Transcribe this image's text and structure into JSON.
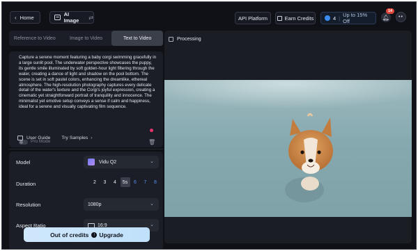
{
  "topbar": {
    "home_label": "Home",
    "ai_image_label": "AI Image",
    "api_label": "API Platform",
    "earn_label": "Earn Credits",
    "credits_count": "4",
    "credits_offer": "Up to 15% Off",
    "notification_count": "14",
    "avatar_glyph": "••"
  },
  "tabs": [
    {
      "label": "Reference to Video",
      "active": false
    },
    {
      "label": "Image to Video",
      "active": false
    },
    {
      "label": "Text to Video",
      "active": true
    }
  ],
  "prompt": {
    "text": "Capture a serene moment featuring a baby corgi swimming gracefully in a large sunlit pool. The underwater perspective showcases the puppy, its gentle smile illuminated by soft golden-hour light filtering through the water, creating a dance of light and shadow on the pool bottom. The scene is set in soft pastel colors, enhancing the dreamlike, ethereal atmosphere. The high-resolution photography captures every delicate detail of the water's texture and the Corgi's joyful expression, creating a cinematic yet straightforward portrait of tranquility and innocence. The minimalist yet emotive setup conveys a sense if calm and happiness, ideal for a serene and visually captivating film sequence.",
    "pro_mode_label": "Pro Mode",
    "pro_mode_on": false
  },
  "links": {
    "user_guide": "User Guide",
    "try_samples": "Try Samples"
  },
  "settings": {
    "model_label": "Model",
    "model_value": "Vidu Q2",
    "duration_label": "Duration",
    "durations": [
      "2",
      "3",
      "4",
      "5s",
      "6",
      "7",
      "8"
    ],
    "duration_selected": "5s",
    "resolution_label": "Resolution",
    "resolution_value": "1080p",
    "aspect_label": "Aspect Ratio",
    "aspect_value": "16:9"
  },
  "action": {
    "out_of_credits": "Out of credits",
    "upgrade": "Upgrade"
  },
  "preview": {
    "status": "Processing"
  },
  "colors": {
    "background": "#0f1117",
    "panel": "#1b1e26",
    "accent_blue": "#5b8ef0",
    "upgrade_button": "#cfe7fb",
    "badge_red": "#e0453a"
  }
}
